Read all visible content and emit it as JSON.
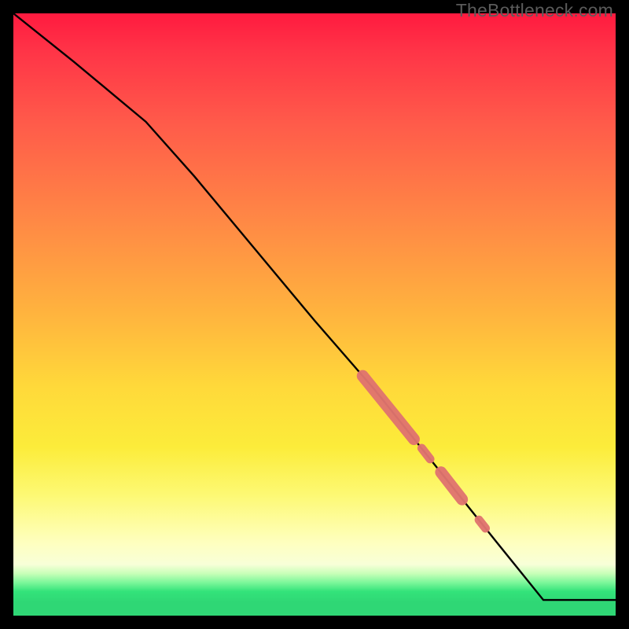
{
  "watermark": "TheBottleneck.com",
  "chart_data": {
    "type": "line",
    "title": "",
    "xlabel": "",
    "ylabel": "",
    "xlim": [
      0,
      100
    ],
    "ylim": [
      0,
      100
    ],
    "grid": false,
    "series": [
      {
        "name": "curve",
        "color": "#000000",
        "x": [
          0,
          10,
          22,
          30,
          40,
          50,
          60,
          70,
          80,
          88,
          100
        ],
        "y": [
          100,
          92,
          82,
          73,
          61,
          49,
          37.5,
          25,
          12.5,
          2.6,
          2.6
        ]
      }
    ],
    "highlight_segments": [
      {
        "x0": 58.0,
        "y0": 39.8,
        "x1": 66.5,
        "y1": 29.3,
        "thick": true
      },
      {
        "x0": 67.8,
        "y0": 27.8,
        "x1": 69.2,
        "y1": 26.0,
        "thick": false
      },
      {
        "x0": 71.0,
        "y0": 23.8,
        "x1": 74.5,
        "y1": 19.3,
        "thick": true
      },
      {
        "x0": 77.3,
        "y0": 15.9,
        "x1": 78.4,
        "y1": 14.5,
        "thick": false
      }
    ],
    "highlight_color": "#e0746f"
  }
}
